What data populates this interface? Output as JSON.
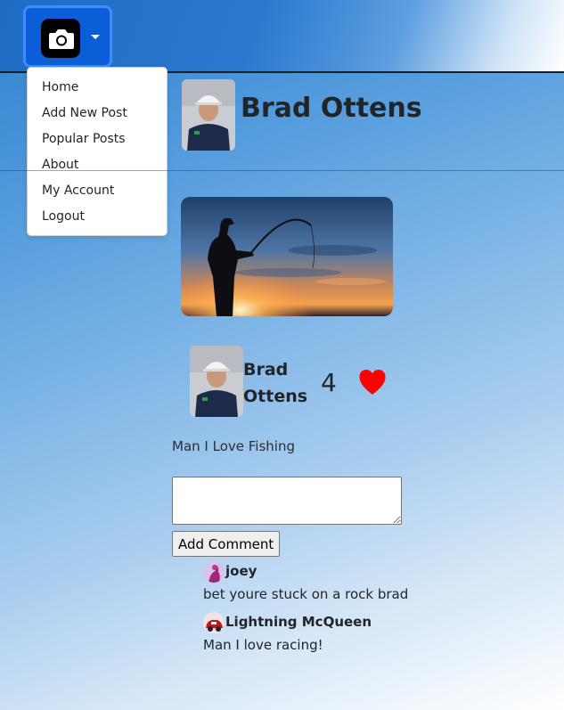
{
  "nav": {
    "menu_icon": "camera-icon",
    "menu_items": [
      "Home",
      "Add New Post",
      "Popular Posts",
      "About",
      "My Account",
      "Logout"
    ]
  },
  "profile": {
    "name": "Brad Ottens"
  },
  "post": {
    "author_name": "Brad Ottens",
    "likes": "4",
    "caption": "Man I Love Fishing"
  },
  "comment_form": {
    "textarea_value": "",
    "submit_label": "Add Comment"
  },
  "comments": [
    {
      "user": "joey",
      "text": "bet youre stuck on a rock brad"
    },
    {
      "user": "Lightning McQueen",
      "text": "Man I love racing!"
    }
  ],
  "colors": {
    "accent": "#0b5ed7",
    "heart": "#ff0000"
  }
}
